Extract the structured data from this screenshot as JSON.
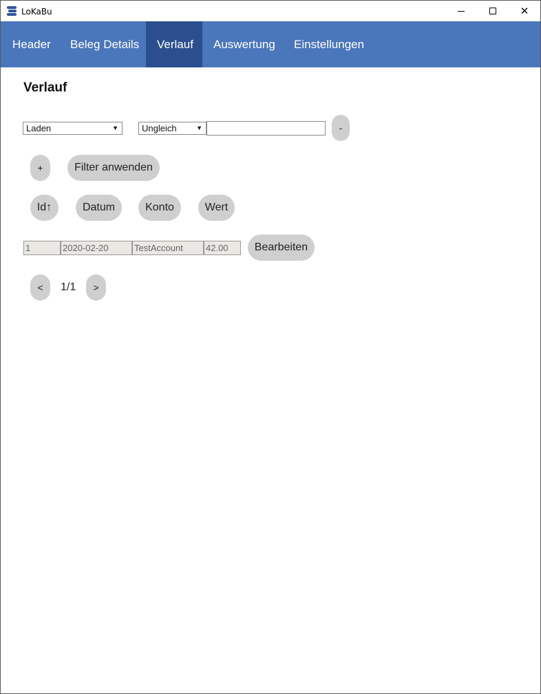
{
  "window": {
    "title": "LoKaBu",
    "icon": "stack-icon",
    "controls": [
      "minimize-icon",
      "maximize-icon",
      "close-icon"
    ],
    "close_glyph": "✕"
  },
  "nav": {
    "items": [
      {
        "label": "Header"
      },
      {
        "label": "Beleg Details"
      },
      {
        "label": "Verlauf",
        "active": true
      },
      {
        "label": "Auswertung"
      },
      {
        "label": "Einstellungen"
      }
    ],
    "colors": {
      "bar": "#4a76bb",
      "active": "#2b4f8e"
    }
  },
  "page": {
    "title": "Verlauf"
  },
  "filter": {
    "field_select": "Laden",
    "operator_select": "Ungleich",
    "value_input": "",
    "remove_label": "-",
    "add_label": "+",
    "apply_label": "Filter anwenden"
  },
  "sort": {
    "buttons": [
      "Id↑",
      "Datum",
      "Konto",
      "Wert"
    ]
  },
  "rows": [
    {
      "id": "1",
      "date": "2020-02-20",
      "account": "TestAccount",
      "value": "42.00",
      "edit_label": "Bearbeiten"
    }
  ],
  "pagination": {
    "prev_label": "<",
    "next_label": ">",
    "indicator": "1/1"
  },
  "colors": {
    "button_bg": "#cfcfcf",
    "readonly_cell_bg": "#eae8e3"
  }
}
